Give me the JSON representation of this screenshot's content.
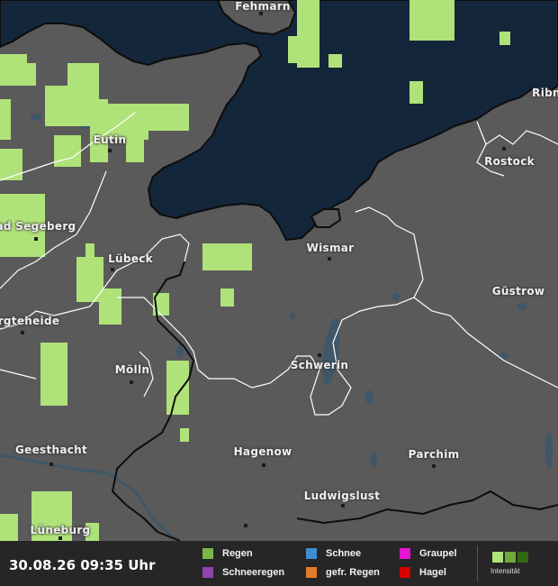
{
  "timestamp": "30.08.26 09:35 Uhr",
  "colors": {
    "sea": "#14263a",
    "land": "#5a5a5a",
    "coast": "#0d0d0d",
    "border": "#ffffff",
    "lake": "#3f5768",
    "rain_light": "#b0e27a"
  },
  "cities": [
    {
      "id": "fehmarn",
      "label": "Fehmarn"
    },
    {
      "id": "ribnitz",
      "label": "Ribn"
    },
    {
      "id": "eutin",
      "label": "Eutin"
    },
    {
      "id": "rostock",
      "label": "Rostock"
    },
    {
      "id": "bad-segeberg",
      "label": "ad Segeberg"
    },
    {
      "id": "wismar",
      "label": "Wismar"
    },
    {
      "id": "luebeck",
      "label": "Lübeck"
    },
    {
      "id": "guestrow",
      "label": "Güstrow"
    },
    {
      "id": "bargteheide",
      "label": "rgteheide"
    },
    {
      "id": "schwerin",
      "label": "Schwerin"
    },
    {
      "id": "moelln",
      "label": "Mölln"
    },
    {
      "id": "geesthacht",
      "label": "Geesthacht"
    },
    {
      "id": "hagenow",
      "label": "Hagenow"
    },
    {
      "id": "parchim",
      "label": "Parchim"
    },
    {
      "id": "ludwigslust",
      "label": "Ludwigslust"
    },
    {
      "id": "lueneburg",
      "label": "Lüneburg"
    }
  ],
  "legend": {
    "items": [
      {
        "id": "regen",
        "label": "Regen",
        "color": "#7ab648"
      },
      {
        "id": "schneeregen",
        "label": "Schneeregen",
        "color": "#8e44ad"
      },
      {
        "id": "schnee",
        "label": "Schnee",
        "color": "#3e8ed0"
      },
      {
        "id": "gefr-regen",
        "label": "gefr. Regen",
        "color": "#e07b2a"
      },
      {
        "id": "graupel",
        "label": "Graupel",
        "color": "#e515d4"
      },
      {
        "id": "hagel",
        "label": "Hagel",
        "color": "#d40000"
      }
    ],
    "intensity_label": "Intensität",
    "intensity_colors": [
      "#b0e27a",
      "#6fa83b",
      "#2f6a12"
    ]
  }
}
